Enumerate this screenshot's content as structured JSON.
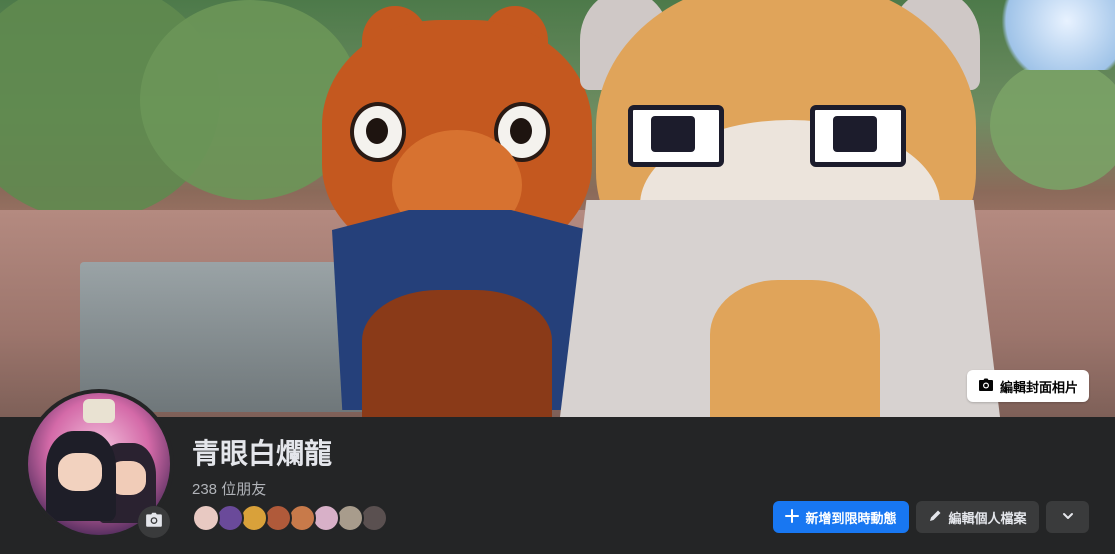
{
  "cover": {
    "edit_label": "編輯封面相片",
    "edit_icon": "camera-icon"
  },
  "profile": {
    "name": "青眼白爛龍",
    "friend_count": "238 位朋友",
    "friend_avatar_colors": [
      "#e8c9c2",
      "#6a4a9a",
      "#d9a13a",
      "#b05a3a",
      "#c87a4a",
      "#d8b0c8",
      "#a89c8c",
      "#5a5050"
    ]
  },
  "actions": {
    "add_story": "新增到限時動態",
    "add_story_icon": "plus-icon",
    "edit_profile": "編輯個人檔案",
    "edit_profile_icon": "pencil-icon",
    "more_icon": "chevron-down-icon"
  },
  "colors": {
    "background": "#242526",
    "primary": "#1877f2",
    "secondary_button": "#3a3b3c",
    "text": "#e4e6eb",
    "muted_text": "#b0b3b8"
  }
}
